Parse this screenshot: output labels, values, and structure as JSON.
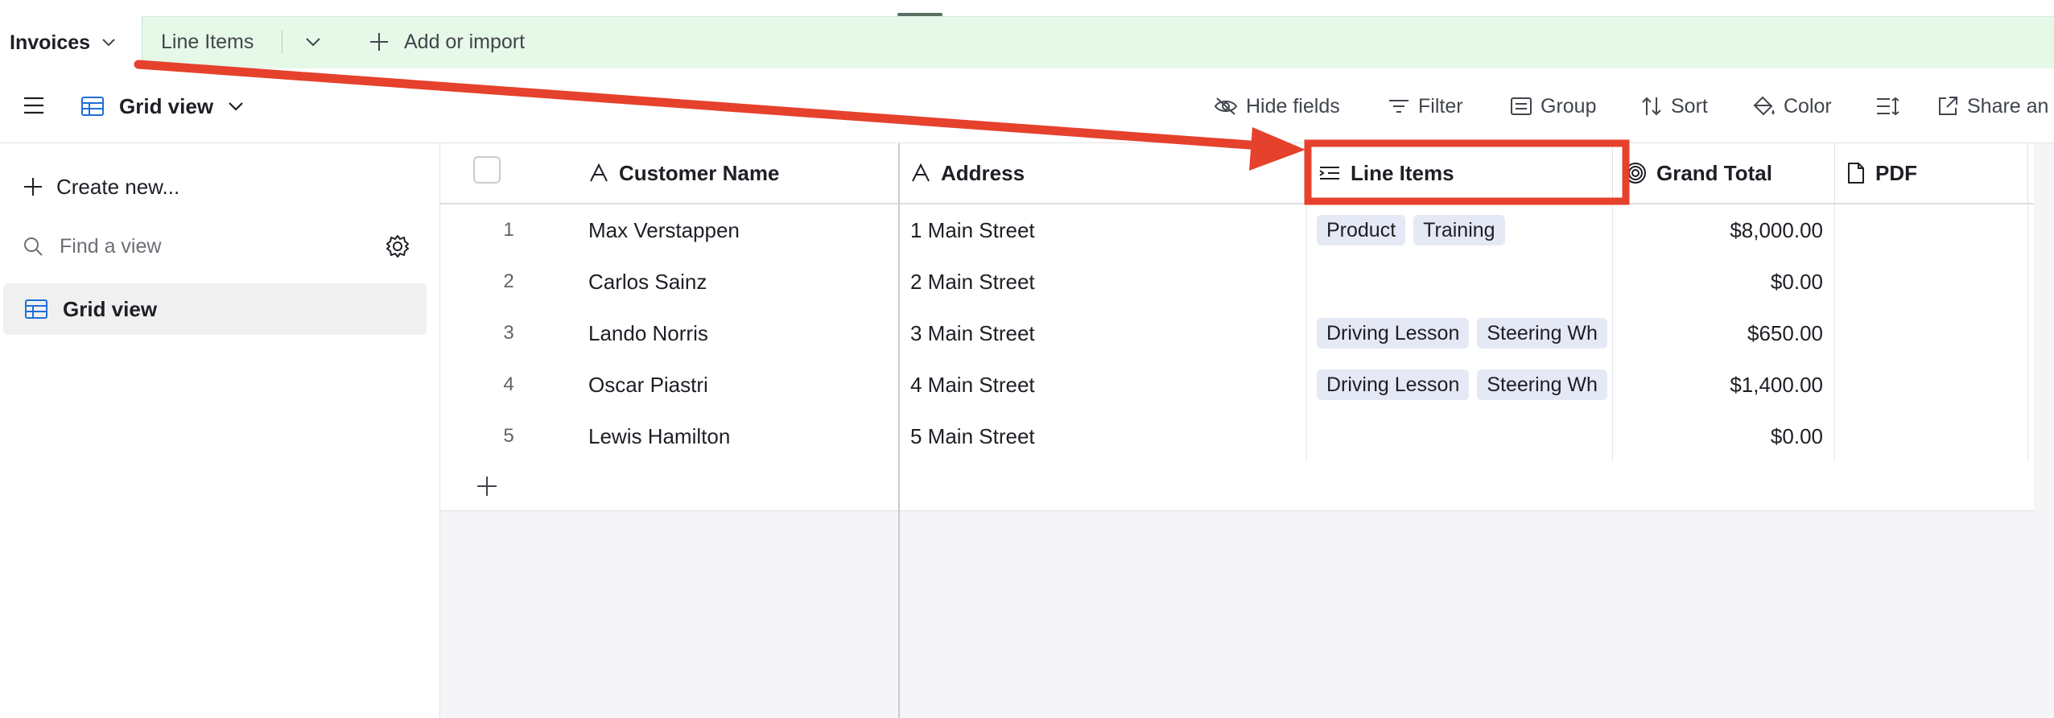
{
  "tabs": {
    "active": "Invoices",
    "second": "Line Items",
    "add": "Add or import"
  },
  "viewbar": {
    "view_name": "Grid view",
    "tools": {
      "hide_fields": "Hide fields",
      "filter": "Filter",
      "group": "Group",
      "sort": "Sort",
      "color": "Color",
      "share": "Share an"
    }
  },
  "sidebar": {
    "create": "Create new...",
    "find_placeholder": "Find a view",
    "items": [
      {
        "label": "Grid view",
        "icon": "grid-icon",
        "selected": true
      }
    ]
  },
  "table": {
    "columns": {
      "customer": "Customer Name",
      "address": "Address",
      "line_items": "Line Items",
      "grand_total": "Grand Total",
      "pdf": "PDF"
    },
    "rows": [
      {
        "num": "1",
        "customer": "Max Verstappen",
        "address": "1 Main Street",
        "chip1": "Product",
        "chip2": "Training",
        "total": "$8,000.00"
      },
      {
        "num": "2",
        "customer": "Carlos Sainz",
        "address": "2 Main Street",
        "chip1": "",
        "chip2": "",
        "total": "$0.00"
      },
      {
        "num": "3",
        "customer": "Lando Norris",
        "address": "3 Main Street",
        "chip1": "Driving Lesson",
        "chip2": "Steering Wh",
        "total": "$650.00"
      },
      {
        "num": "4",
        "customer": "Oscar Piastri",
        "address": "4 Main Street",
        "chip1": "Driving Lesson",
        "chip2": "Steering Wh",
        "total": "$1,400.00"
      },
      {
        "num": "5",
        "customer": "Lewis Hamilton",
        "address": "5 Main Street",
        "chip1": "",
        "chip2": "",
        "total": "$0.00"
      }
    ]
  },
  "colors": {
    "tabbar_bg": "#e6f8e7",
    "accent_blue": "#1f6fd6",
    "chip_bg": "#e5e9f6",
    "annotation_red": "#e5412d"
  }
}
